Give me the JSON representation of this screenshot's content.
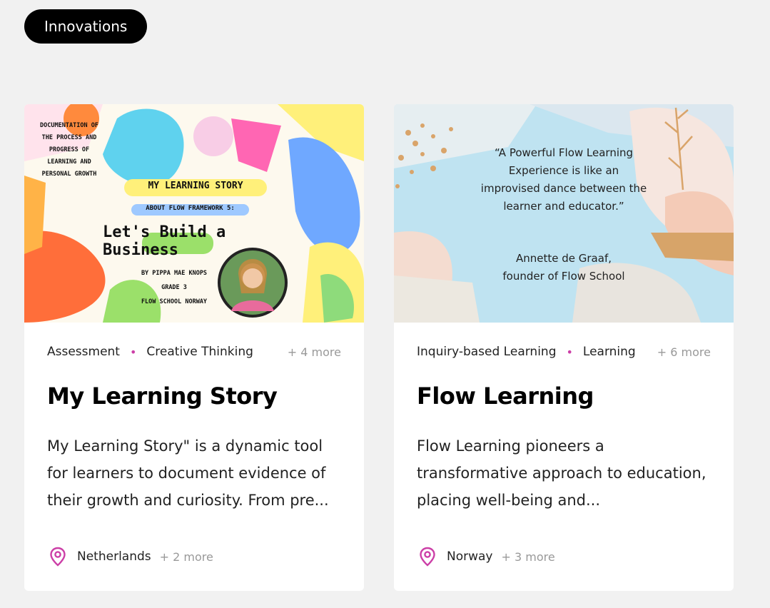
{
  "category_pill": "Innovations",
  "cards": [
    {
      "image": {
        "doc_caption": "DOCUMENTATION OF THE PROCESS AND PROGRESS OF LEARNING AND PERSONAL GROWTH",
        "banner": "MY LEARNING STORY",
        "sub_banner": "ABOUT FLOW FRAMEWORK 5:",
        "headline": "Let's Build a Business",
        "byline": "BY PIPPA MAE KNOPS",
        "grade": "GRADE 3",
        "school": "FLOW SCHOOL NORWAY"
      },
      "tags": [
        "Assessment",
        "Creative Thinking"
      ],
      "tags_more": "+ 4 more",
      "title": "My Learning Story",
      "description": "My Learning Story\" is a dynamic tool for learners to document evidence of their growth and curiosity. From pre...",
      "location": "Netherlands",
      "location_more": "+ 2 more"
    },
    {
      "image": {
        "quote": "“A Powerful Flow Learning Experience is like an improvised dance between the learner and educator.”",
        "author_name": "Annette de Graaf,",
        "author_role": "founder of Flow School"
      },
      "tags": [
        "Inquiry-based Learning",
        "Learning"
      ],
      "tags_more": "+ 6 more",
      "title": "Flow Learning",
      "description": "Flow Learning pioneers a transformative approach to education, placing well-being and...",
      "location": "Norway",
      "location_more": "+ 3 more"
    }
  ],
  "colors": {
    "accent": "#cc3fa7",
    "pill_bg": "#000000",
    "page_bg": "#f1f1f1"
  },
  "icons": [
    "map-pin-icon"
  ]
}
